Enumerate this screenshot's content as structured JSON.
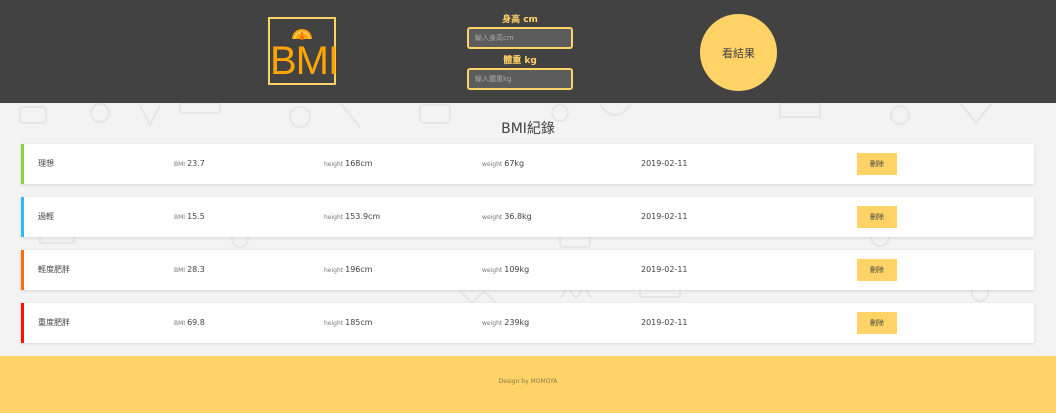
{
  "header": {
    "logo_text": "BMI",
    "height_label": "身高 cm",
    "height_placeholder": "輸入身高cm",
    "weight_label": "體重 kg",
    "weight_placeholder": "輸入體重kg",
    "result_button": "看結果"
  },
  "main": {
    "title": "BMI紀錄",
    "key_bmi": "BMI",
    "key_height": "height",
    "key_weight": "weight",
    "delete_label": "刪除",
    "records": [
      {
        "status": "理想",
        "bmi": "23.7",
        "height": "168cm",
        "weight": "67kg",
        "date": "2019-02-11",
        "color": "#86d73f"
      },
      {
        "status": "過輕",
        "bmi": "15.5",
        "height": "153.9cm",
        "weight": "36.8kg",
        "date": "2019-02-11",
        "color": "#31baf9"
      },
      {
        "status": "輕度肥胖",
        "bmi": "28.3",
        "height": "196cm",
        "weight": "109kg",
        "date": "2019-02-11",
        "color": "#ff6c02"
      },
      {
        "status": "重度肥胖",
        "bmi": "69.8",
        "height": "185cm",
        "weight": "239kg",
        "date": "2019-02-11",
        "color": "#ff1200"
      }
    ]
  },
  "footer": {
    "text": "Design by MOMOYA"
  },
  "colors": {
    "header_bg": "#424242",
    "accent": "#ffd366",
    "logo_orange": "#ffa400"
  }
}
